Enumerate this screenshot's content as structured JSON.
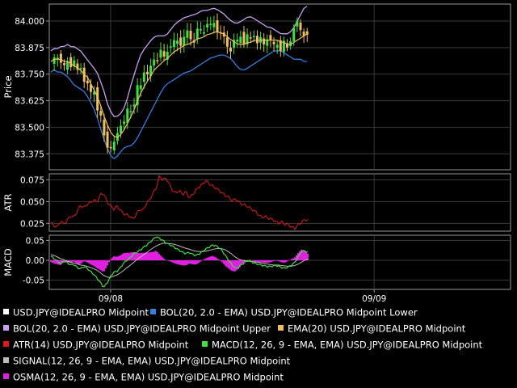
{
  "chart_data": [
    {
      "type": "candlestick",
      "name": "price-panel",
      "ylabel": "Price",
      "ylim": [
        83.3,
        84.08
      ],
      "ticks": [
        "84.000",
        "83.875",
        "83.750",
        "83.625",
        "83.500",
        "83.375"
      ],
      "tick_values": [
        84.0,
        83.875,
        83.75,
        83.625,
        83.5,
        83.375
      ],
      "x_points": [
        0,
        4,
        8,
        12,
        16,
        20,
        24,
        28,
        32,
        36,
        40,
        44,
        48,
        52,
        56,
        60,
        64,
        68,
        72,
        76,
        80,
        84,
        88,
        92,
        96,
        100,
        104,
        108,
        112,
        116,
        120,
        124,
        128,
        132,
        136,
        140,
        144,
        148,
        152,
        156,
        160,
        164,
        168,
        172,
        176,
        180,
        184,
        188,
        192,
        196,
        200,
        204,
        208,
        212,
        216,
        220,
        224,
        228,
        232,
        236,
        240,
        244,
        248,
        252,
        256,
        260,
        264,
        268,
        272,
        276,
        280,
        284,
        288,
        292,
        296,
        300,
        304,
        308,
        310
      ],
      "series": [
        {
          "name": "BOL(20, 2.0 - EMA) USD.JPY@IDEALPRO Midpoint Upper",
          "color": "#c8a0f0",
          "values": [
            83.86,
            83.87,
            83.87,
            83.88,
            83.88,
            83.89,
            83.88,
            83.88,
            83.87,
            83.86,
            83.84,
            83.82,
            83.8,
            83.78,
            83.76,
            83.72,
            83.68,
            83.62,
            83.58,
            83.55,
            83.55,
            83.56,
            83.58,
            83.62,
            83.68,
            83.73,
            83.78,
            83.83,
            83.86,
            83.88,
            83.9,
            83.92,
            83.93,
            83.93,
            83.93,
            83.93,
            83.95,
            83.97,
            83.99,
            84.0,
            84.01,
            84.02,
            84.02,
            84.03,
            84.03,
            84.04,
            84.05,
            84.05,
            84.05,
            84.06,
            84.06,
            84.05,
            84.04,
            84.03,
            84.01,
            84.0,
            83.99,
            83.99,
            84.0,
            84.01,
            84.02,
            84.02,
            84.01,
            84.0,
            83.99,
            83.98,
            83.97,
            83.97,
            83.96,
            83.95,
            83.94,
            83.94,
            83.94,
            83.95,
            83.97,
            84.0,
            84.03,
            84.06,
            84.07
          ]
        },
        {
          "name": "BOL(20, 2.0 - EMA) USD.JPY@IDEALPRO Midpoint Lower",
          "color": "#2f7fe0",
          "values": [
            83.76,
            83.77,
            83.76,
            83.76,
            83.75,
            83.74,
            83.72,
            83.7,
            83.69,
            83.68,
            83.67,
            83.65,
            83.62,
            83.59,
            83.55,
            83.5,
            83.45,
            83.41,
            83.37,
            83.35,
            83.36,
            83.38,
            83.4,
            83.41,
            83.41,
            83.42,
            83.44,
            83.47,
            83.5,
            83.53,
            83.56,
            83.59,
            83.62,
            83.65,
            83.68,
            83.7,
            83.71,
            83.72,
            83.73,
            83.74,
            83.75,
            83.76,
            83.76,
            83.77,
            83.78,
            83.79,
            83.8,
            83.81,
            83.82,
            83.83,
            83.83,
            83.84,
            83.84,
            83.84,
            83.83,
            83.82,
            83.8,
            83.78,
            83.77,
            83.77,
            83.78,
            83.79,
            83.8,
            83.81,
            83.82,
            83.83,
            83.84,
            83.85,
            83.86,
            83.86,
            83.86,
            83.85,
            83.84,
            83.83,
            83.82,
            83.82,
            83.82,
            83.81,
            83.81
          ]
        },
        {
          "name": "EMA(20) USD.JPY@IDEALPRO Midpoint",
          "color": "#f0c060",
          "values": [
            83.81,
            83.82,
            83.82,
            83.82,
            83.81,
            83.81,
            83.8,
            83.79,
            83.78,
            83.77,
            83.75,
            83.74,
            83.71,
            83.68,
            83.65,
            83.61,
            83.56,
            83.52,
            83.48,
            83.46,
            83.45,
            83.46,
            83.48,
            83.51,
            83.54,
            83.57,
            83.61,
            83.65,
            83.68,
            83.71,
            83.73,
            83.76,
            83.78,
            83.79,
            83.81,
            83.82,
            83.83,
            83.85,
            83.86,
            83.87,
            83.88,
            83.89,
            83.89,
            83.9,
            83.91,
            83.92,
            83.92,
            83.93,
            83.94,
            83.94,
            83.95,
            83.95,
            83.94,
            83.94,
            83.92,
            83.91,
            83.9,
            83.89,
            83.89,
            83.89,
            83.9,
            83.9,
            83.91,
            83.91,
            83.91,
            83.91,
            83.91,
            83.91,
            83.91,
            83.91,
            83.9,
            83.9,
            83.89,
            83.89,
            83.9,
            83.91,
            83.92,
            83.93,
            83.94
          ]
        },
        {
          "name": "USD.JPY@IDEALPRO Midpoint",
          "color": "#ffffff",
          "values": [
            83.79,
            83.83,
            83.84,
            83.8,
            83.78,
            83.82,
            83.79,
            83.81,
            83.76,
            83.8,
            83.72,
            83.7,
            83.66,
            83.7,
            83.58,
            83.56,
            83.48,
            83.42,
            83.39,
            83.41,
            83.47,
            83.52,
            83.49,
            83.58,
            83.6,
            83.56,
            83.7,
            83.66,
            83.78,
            83.75,
            83.73,
            83.86,
            83.78,
            83.88,
            83.82,
            83.84,
            83.9,
            83.86,
            83.94,
            83.88,
            83.91,
            83.93,
            83.96,
            83.89,
            83.92,
            83.98,
            83.94,
            83.97,
            84.0,
            83.96,
            84.01,
            83.93,
            83.95,
            83.9,
            83.88,
            83.86,
            83.92,
            83.9,
            83.95,
            83.88,
            83.94,
            83.91,
            83.95,
            83.88,
            83.92,
            83.89,
            83.93,
            83.9,
            83.88,
            83.9,
            83.86,
            83.9,
            83.87,
            83.92,
            83.97,
            83.99,
            83.96,
            83.94,
            83.93
          ]
        }
      ]
    },
    {
      "type": "line",
      "name": "atr-panel",
      "ylabel": "ATR",
      "ylim": [
        0.016,
        0.082
      ],
      "ticks": [
        "0.075",
        "0.050",
        "0.025"
      ],
      "tick_values": [
        0.075,
        0.05,
        0.025
      ],
      "series": [
        {
          "name": "ATR(14) USD.JPY@IDEALPRO Midpoint",
          "color": "#e01818",
          "values": [
            0.026,
            0.022,
            0.021,
            0.028,
            0.024,
            0.029,
            0.034,
            0.032,
            0.039,
            0.046,
            0.043,
            0.047,
            0.049,
            0.052,
            0.049,
            0.058,
            0.06,
            0.05,
            0.046,
            0.041,
            0.045,
            0.041,
            0.036,
            0.035,
            0.033,
            0.03,
            0.036,
            0.041,
            0.04,
            0.048,
            0.052,
            0.06,
            0.066,
            0.08,
            0.075,
            0.077,
            0.07,
            0.062,
            0.06,
            0.063,
            0.058,
            0.062,
            0.054,
            0.058,
            0.063,
            0.067,
            0.07,
            0.074,
            0.071,
            0.068,
            0.066,
            0.063,
            0.06,
            0.057,
            0.055,
            0.051,
            0.053,
            0.05,
            0.047,
            0.046,
            0.044,
            0.041,
            0.039,
            0.035,
            0.032,
            0.033,
            0.031,
            0.03,
            0.028,
            0.025,
            0.027,
            0.024,
            0.024,
            0.021,
            0.019,
            0.023,
            0.026,
            0.029,
            0.029
          ]
        }
      ]
    },
    {
      "type": "line",
      "name": "macd-panel",
      "ylabel": "MACD",
      "ylim": [
        -0.073,
        0.063
      ],
      "ticks": [
        "0.05",
        "0.00",
        "-0.05"
      ],
      "tick_values": [
        0.05,
        0.0,
        -0.05
      ],
      "series": [
        {
          "name": "MACD(12, 26, 9 - EMA, EMA) USD.JPY@IDEALPRO Midpoint",
          "color": "#40e040",
          "values": [
            0.01,
            0.004,
            -0.002,
            -0.008,
            -0.002,
            -0.006,
            -0.012,
            -0.01,
            -0.018,
            -0.022,
            -0.015,
            -0.02,
            -0.028,
            -0.035,
            -0.045,
            -0.055,
            -0.068,
            -0.058,
            -0.042,
            -0.03,
            -0.028,
            -0.02,
            -0.008,
            0.0,
            0.006,
            0.015,
            0.02,
            0.025,
            0.032,
            0.038,
            0.045,
            0.052,
            0.06,
            0.055,
            0.05,
            0.043,
            0.04,
            0.035,
            0.03,
            0.025,
            0.02,
            0.017,
            0.02,
            0.015,
            0.012,
            0.016,
            0.022,
            0.028,
            0.033,
            0.038,
            0.037,
            0.032,
            0.024,
            0.012,
            0.0,
            -0.012,
            -0.02,
            -0.018,
            -0.01,
            -0.005,
            0.0,
            -0.004,
            -0.008,
            -0.01,
            -0.012,
            -0.014,
            -0.016,
            -0.015,
            -0.013,
            -0.014,
            -0.018,
            -0.02,
            -0.017,
            -0.012,
            -0.006,
            0.008,
            0.022,
            0.024,
            0.02
          ]
        },
        {
          "name": "SIGNAL(12, 26, 9 - EMA, EMA) USD.JPY@IDEALPRO Midpoint",
          "color": "#bbbbbb",
          "values": [
            0.014,
            0.012,
            0.008,
            0.004,
            0.001,
            -0.002,
            -0.005,
            -0.007,
            -0.009,
            -0.012,
            -0.013,
            -0.015,
            -0.018,
            -0.021,
            -0.025,
            -0.031,
            -0.038,
            -0.042,
            -0.043,
            -0.04,
            -0.037,
            -0.032,
            -0.026,
            -0.019,
            -0.013,
            -0.006,
            0.001,
            0.007,
            0.013,
            0.019,
            0.025,
            0.031,
            0.036,
            0.04,
            0.043,
            0.043,
            0.042,
            0.041,
            0.039,
            0.036,
            0.033,
            0.03,
            0.028,
            0.025,
            0.023,
            0.022,
            0.022,
            0.023,
            0.025,
            0.027,
            0.029,
            0.03,
            0.029,
            0.026,
            0.021,
            0.015,
            0.008,
            0.003,
            0.0,
            -0.001,
            -0.002,
            -0.003,
            -0.004,
            -0.005,
            -0.007,
            -0.008,
            -0.01,
            -0.011,
            -0.012,
            -0.012,
            -0.013,
            -0.014,
            -0.015,
            -0.015,
            -0.013,
            -0.01,
            -0.005,
            0.0,
            0.003
          ]
        },
        {
          "name": "OSMA(12, 26, 9 - EMA, EMA) USD.JPY@IDEALPRO Midpoint",
          "color": "#e020e0",
          "values": [
            -0.004,
            -0.008,
            -0.01,
            -0.012,
            -0.003,
            -0.004,
            -0.007,
            -0.003,
            -0.009,
            -0.01,
            -0.002,
            -0.005,
            -0.01,
            -0.014,
            -0.02,
            -0.024,
            -0.03,
            -0.016,
            0.001,
            0.01,
            0.009,
            0.012,
            0.018,
            0.019,
            0.019,
            0.021,
            0.019,
            0.018,
            0.019,
            0.019,
            0.02,
            0.021,
            0.024,
            0.015,
            0.007,
            0.0,
            -0.002,
            -0.006,
            -0.009,
            -0.011,
            -0.013,
            -0.013,
            -0.008,
            -0.01,
            -0.011,
            -0.006,
            0.0,
            0.005,
            0.008,
            0.011,
            0.008,
            0.002,
            -0.005,
            -0.014,
            -0.021,
            -0.027,
            -0.028,
            -0.021,
            -0.01,
            -0.004,
            0.002,
            -0.001,
            -0.004,
            -0.005,
            -0.005,
            -0.006,
            -0.006,
            -0.004,
            -0.001,
            -0.002,
            -0.005,
            -0.006,
            -0.002,
            0.003,
            0.007,
            0.018,
            0.027,
            0.024,
            0.017
          ]
        }
      ]
    }
  ],
  "x_axis": {
    "ticks": [
      {
        "label": "09/08",
        "index": 17
      },
      {
        "label": "09/09",
        "index": 92
      }
    ],
    "domain_points": 96
  },
  "legend": [
    {
      "label": "USD.JPY@IDEALPRO Midpoint",
      "color": "#ffffff"
    },
    {
      "label": "BOL(20, 2.0 - EMA) USD.JPY@IDEALPRO Midpoint Lower",
      "color": "#2f7fe0"
    },
    {
      "label": "BOL(20, 2.0 - EMA) USD.JPY@IDEALPRO Midpoint Upper",
      "color": "#c8a0f0"
    },
    {
      "label": "EMA(20) USD.JPY@IDEALPRO Midpoint",
      "color": "#f0c060"
    },
    {
      "label": "ATR(14) USD.JPY@IDEALPRO Midpoint",
      "color": "#e01818"
    },
    {
      "label": "MACD(12, 26, 9 - EMA, EMA) USD.JPY@IDEALPRO Midpoint",
      "color": "#40e040"
    },
    {
      "label": "SIGNAL(12, 26, 9 - EMA, EMA) USD.JPY@IDEALPRO Midpoint",
      "color": "#bbbbbb"
    },
    {
      "label": "OSMA(12, 26, 9 - EMA, EMA) USD.JPY@IDEALPRO Midpoint",
      "color": "#e020e0"
    }
  ],
  "colors": {
    "background": "#000000",
    "grid": "#3a3a3a",
    "frame": "#9a9a9a",
    "up_candle": "#40e040",
    "down_candle": "#f0c060"
  }
}
